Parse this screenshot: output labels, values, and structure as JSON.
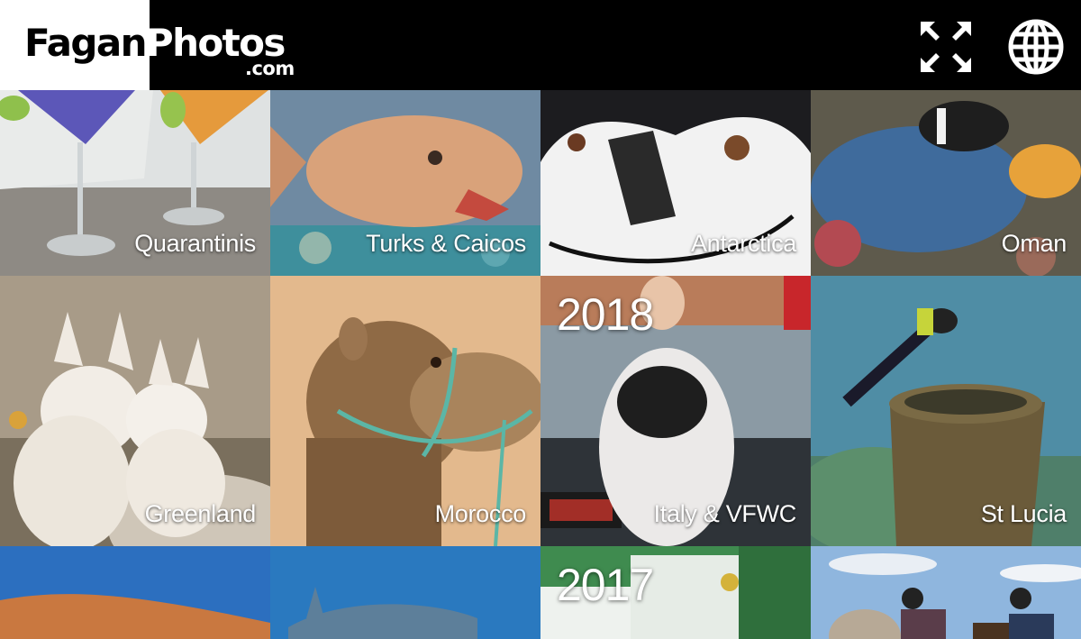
{
  "header": {
    "logo_main_dark": "Fagan",
    "logo_main_light": "Photos",
    "logo_sub": ".com",
    "icons": [
      "fullscreen-expand-icon",
      "globe-icon"
    ]
  },
  "gallery": {
    "tiles": [
      {
        "label": "Quarantinis"
      },
      {
        "label": "Turks & Caicos"
      },
      {
        "label": "Antarctica"
      },
      {
        "label": "Oman"
      },
      {
        "label": "Greenland"
      },
      {
        "label": "Morocco"
      },
      {
        "label": "Italy & VFWC",
        "year": "2018"
      },
      {
        "label": "St Lucia"
      },
      {
        "label": ""
      },
      {
        "label": ""
      },
      {
        "label": "",
        "year": "2017"
      },
      {
        "label": ""
      }
    ]
  },
  "colors": {
    "header_bg": "#000000",
    "logo_bg": "#ffffff",
    "label_text": "#ffffff"
  }
}
